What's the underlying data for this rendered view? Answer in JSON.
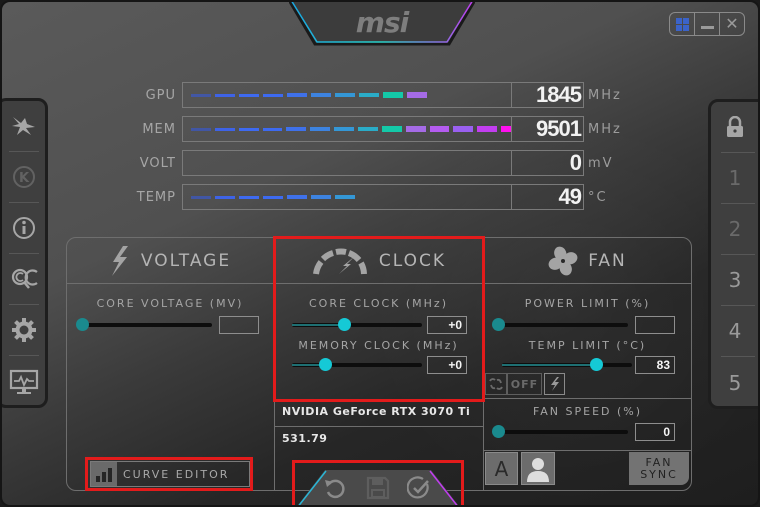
{
  "app": {
    "logo": "msi"
  },
  "window_controls": {
    "windows_icon": "windows-logo-icon",
    "minimize_icon": "minimize-icon",
    "close_icon": "close-icon"
  },
  "left_sidebar": {
    "items": [
      {
        "name": "kombustor-icon",
        "label": "Kombustor"
      },
      {
        "name": "k-boost-icon",
        "label": "K"
      },
      {
        "name": "info-icon",
        "label": "Info"
      },
      {
        "name": "oc-scanner-icon",
        "label": "OC Scanner"
      },
      {
        "name": "settings-gear-icon",
        "label": "Settings"
      },
      {
        "name": "monitor-icon",
        "label": "Hardware Monitor"
      }
    ]
  },
  "right_sidebar": {
    "lock_icon": "lock-icon",
    "profiles": [
      "1",
      "2",
      "3",
      "4",
      "5"
    ]
  },
  "monitor": {
    "rows": [
      {
        "label": "GPU",
        "value": "1845",
        "unit": "MHz",
        "level_segments": 10,
        "max_segments": 14
      },
      {
        "label": "MEM",
        "value": "9501",
        "unit": "MHz",
        "level_segments": 14,
        "max_segments": 14
      },
      {
        "label": "VOLT",
        "value": "0",
        "unit": "mV",
        "level_segments": 0,
        "max_segments": 14
      },
      {
        "label": "TEMP",
        "value": "49",
        "unit": "°C",
        "level_segments": 7,
        "max_segments": 14
      }
    ],
    "segment_colors": [
      "#3a58c8",
      "#3e63e6",
      "#3e6af0",
      "#3d6af0",
      "#3f71ea",
      "#3d83e0",
      "#3497d6",
      "#2aacc8",
      "#14c9a8",
      "#a56be6",
      "#b45cf0",
      "#9a60f0",
      "#c23ef0",
      "#ff10f0"
    ]
  },
  "voltage": {
    "title": "VOLTAGE",
    "core_voltage_label": "CORE VOLTAGE  (MV)",
    "core_voltage_value": "",
    "core_voltage_slider_fraction": 0.0
  },
  "clock": {
    "title": "CLOCK",
    "core_clock_label": "CORE CLOCK (MHz)",
    "core_clock_value": "+0",
    "core_clock_slider_fraction": 0.4,
    "memory_clock_label": "MEMORY CLOCK (MHz)",
    "memory_clock_value": "+0",
    "memory_clock_slider_fraction": 0.25
  },
  "fan": {
    "title": "FAN",
    "power_limit_label": "POWER LIMIT (%)",
    "power_limit_value": "",
    "power_limit_slider_fraction": 0.0,
    "temp_limit_label": "TEMP LIMIT (°C)",
    "temp_limit_value": "83",
    "temp_limit_slider_fraction": 0.72,
    "link_label": "OFF",
    "fan_speed_label": "FAN SPEED (%)",
    "fan_speed_value": "0",
    "fan_speed_slider_fraction": 0.0,
    "auto_label": "A",
    "fan_sync_label_1": "FAN",
    "fan_sync_label_2": "SYNC"
  },
  "gpu_info": {
    "name": "NVIDIA GeForce RTX 3070 Ti",
    "driver": "531.79"
  },
  "bottom": {
    "curve_editor_label": "CURVE EDITOR",
    "reset_icon": "reset-icon",
    "save_icon": "save-icon",
    "apply_icon": "apply-check-icon"
  },
  "highlight_color": "#e31b1b",
  "accent_color": "#15c9d6"
}
